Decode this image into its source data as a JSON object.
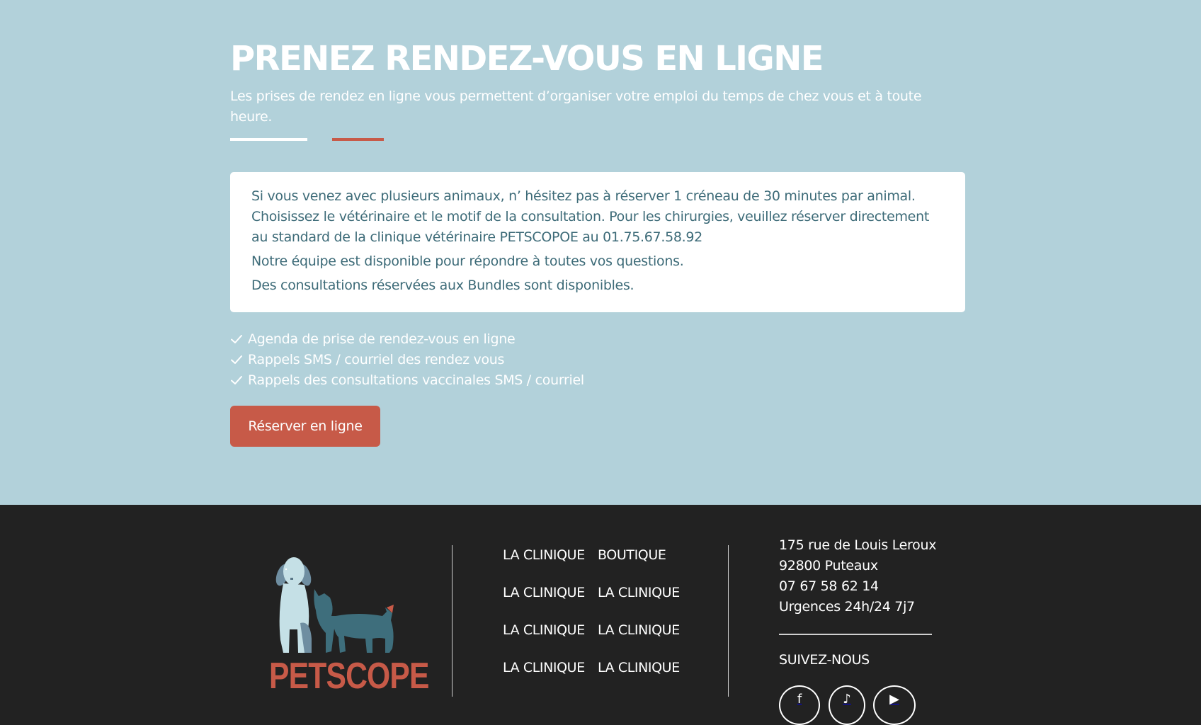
{
  "hero": {
    "title": "PRENEZ RENDEZ-VOUS EN LIGNE",
    "subtitle": "Les prises de rendez en ligne vous permettent d’organiser votre emploi du temps de chez vous et à toute heure.",
    "card": {
      "paragraph1": "Si vous venez avec plusieurs animaux, n’ hésitez pas à réserver 1 créneau de 30 minutes par animal. Choisissez le vétérinaire et le motif de la consultation. Pour les chirurgies, veuillez réserver directement au standard de la clinique vétérinaire PETSCOPOE au 01.75.67.58.92",
      "paragraph2": "Notre équipe est disponible pour répondre à toutes vos questions.",
      "paragraph3": "Des consultations réservées aux Bundles sont disponibles."
    },
    "features": [
      "Agenda de prise de rendez-vous en ligne",
      "Rappels SMS / courriel des rendez vous",
      "Rappels des consultations vaccinales SMS / courriel"
    ],
    "cta_label": "Réserver en ligne",
    "colors": {
      "background": "#b2d1da",
      "accent": "#c75a48",
      "card_text": "#3d6b78"
    }
  },
  "footer": {
    "logo_text": "PETSCOPE",
    "nav_col1": [
      "LA CLINIQUE",
      "LA CLINIQUE",
      "LA CLINIQUE",
      "LA CLINIQUE"
    ],
    "nav_col2": [
      "BOUTIQUE",
      "LA CLINIQUE",
      "LA CLINIQUE",
      "LA CLINIQUE"
    ],
    "address_line1": "175 rue de Louis Leroux",
    "address_line2": "92800 Puteaux",
    "phone": "07 67 58 62 14",
    "emergency": "Urgences 24h/24 7j7",
    "follow_label": "SUIVEZ-NOUS",
    "social_icons": [
      "facebook-icon",
      "tiktok-icon",
      "youtube-icon"
    ],
    "colors": {
      "background": "#222222",
      "logo": "#c75a48"
    }
  }
}
